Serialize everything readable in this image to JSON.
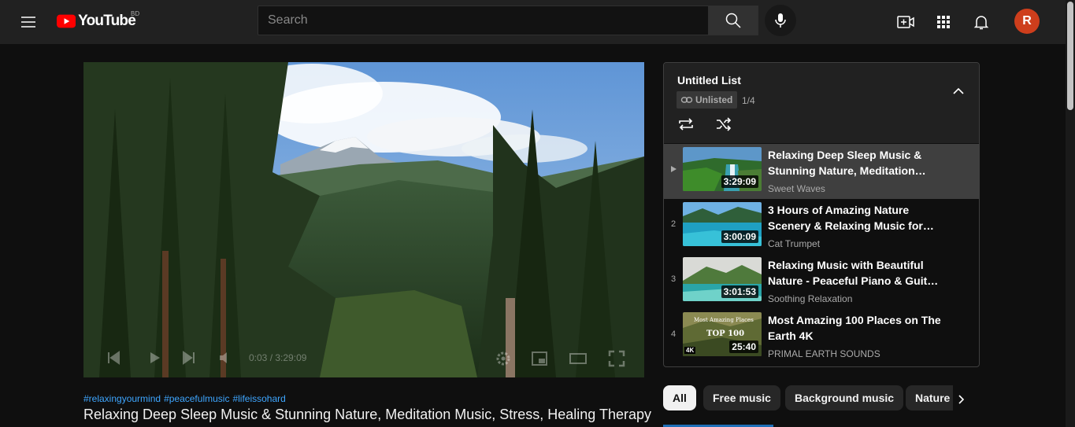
{
  "header": {
    "logo_text": "YouTube",
    "country_code": "BD",
    "search_placeholder": "Search",
    "avatar_letter": "R",
    "icons": [
      "menu-icon",
      "search-icon",
      "mic-icon",
      "create-icon",
      "apps-icon",
      "bell-icon"
    ]
  },
  "player": {
    "time_current": "0:03",
    "time_total": "3:29:09"
  },
  "video": {
    "hashtags": [
      "#relaxingyourmind",
      "#peacefulmusic",
      "#lifeissohard"
    ],
    "title": "Relaxing Deep Sleep Music & Stunning Nature, Meditation Music, Stress, Healing Therapy"
  },
  "playlist": {
    "title": "Untitled List",
    "visibility": "Unlisted",
    "position": "1/4",
    "items": [
      {
        "index": "",
        "title_line1": "Relaxing Deep Sleep Music &",
        "title_line2": "Stunning Nature, Meditation…",
        "channel": "Sweet Waves",
        "duration": "3:29:09",
        "active": true
      },
      {
        "index": "2",
        "title_line1": "3 Hours of Amazing Nature",
        "title_line2": "Scenery & Relaxing Music for…",
        "channel": "Cat Trumpet",
        "duration": "3:00:09",
        "active": false
      },
      {
        "index": "3",
        "title_line1": "Relaxing Music with Beautiful",
        "title_line2": "Nature - Peaceful Piano & Guita…",
        "channel": "Soothing Relaxation",
        "duration": "3:01:53",
        "active": false
      },
      {
        "index": "4",
        "title_line1": "Most Amazing 100 Places on The",
        "title_line2": "Earth 4K",
        "channel": "PRIMAL EARTH SOUNDS",
        "duration": "25:40",
        "active": false
      }
    ],
    "thumb4_text_line1": "Most Amazing Places",
    "thumb4_text_line2": "TOP 100",
    "thumb4_badge": "4K"
  },
  "chips": [
    "All",
    "Free music",
    "Background music",
    "Nature"
  ],
  "colors": {
    "background": "#0f0f0f",
    "header": "#212121",
    "accent_red": "#ff0000",
    "hashtag_blue": "#3ea6ff",
    "avatar": "#ce3e1c"
  }
}
